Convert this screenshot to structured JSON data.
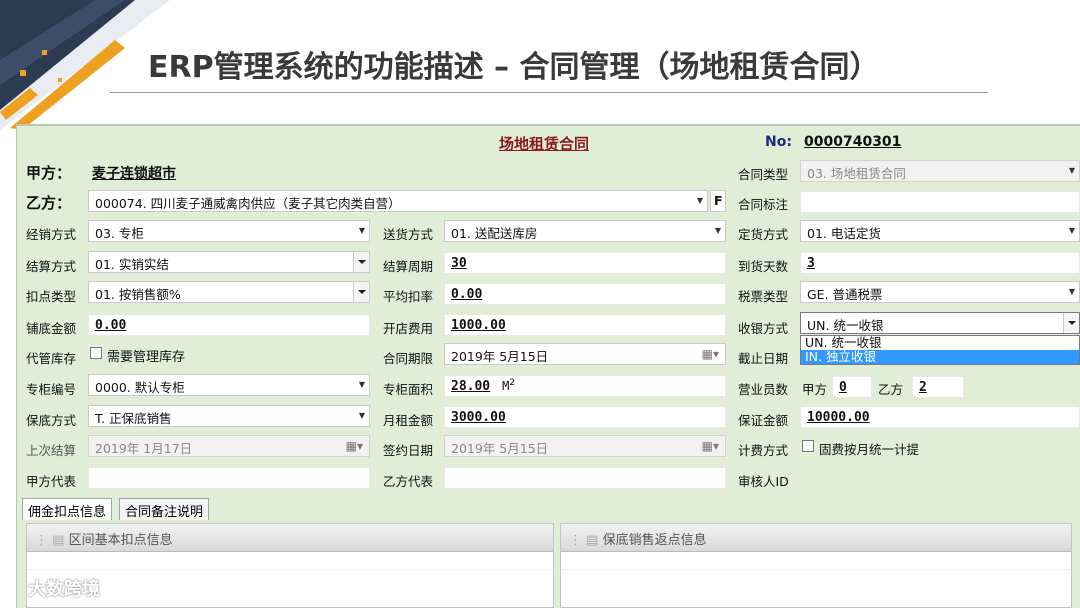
{
  "slide": {
    "title": "ERP管理系统的功能描述 – 合同管理（场地租赁合同）",
    "watermark": "大数跨境"
  },
  "form": {
    "title": "场地租赁合同",
    "no_label": "No:",
    "no_value": "0000740301",
    "party_a_label": "甲方：",
    "party_a_value": "麦子连锁超市",
    "party_b_label": "乙方：",
    "party_b_value": "000074. 四川麦子通威禽肉供应（麦子其它肉类自营）",
    "f_button": "F",
    "contract_type_label": "合同类型",
    "contract_type_value": "03. 场地租赁合同",
    "contract_tag_label": "合同标注",
    "contract_tag_value": "",
    "sales_mode_label": "经销方式",
    "sales_mode_value": "03. 专柜",
    "delivery_mode_label": "送货方式",
    "delivery_mode_value": "01. 送配送库房",
    "order_mode_label": "定货方式",
    "order_mode_value": "01. 电话定货",
    "settle_mode_label": "结算方式",
    "settle_mode_value": "01. 实销实结",
    "settle_period_label": "结算周期",
    "settle_period_value": "30",
    "arrival_days_label": "到货天数",
    "arrival_days_value": "3",
    "deduction_type_label": "扣点类型",
    "deduction_type_value": "01. 按销售额%",
    "avg_rate_label": "平均扣率",
    "avg_rate_value": "0.00",
    "tax_type_label": "税票类型",
    "tax_type_value": "GE. 普通税票",
    "base_amount_label": "铺底金额",
    "base_amount_value": "0.00",
    "opening_fee_label": "开店费用",
    "opening_fee_value": "1000.00",
    "cashier_mode_label": "收银方式",
    "cashier_mode_value": "UN. 统一收银",
    "cashier_options": [
      "UN. 统一收银",
      "IN. 独立收银"
    ],
    "consign_label": "代管库存",
    "consign_check_label": "需要管理库存",
    "contract_period_label": "合同期限",
    "contract_period_value": "2019年  5月15日",
    "end_date_label": "截止日期",
    "counter_no_label": "专柜编号",
    "counter_no_value": "0000. 默认专柜",
    "counter_area_label": "专柜面积",
    "counter_area_value": "28.00",
    "counter_area_unit": "M",
    "counter_area_sup": "2",
    "staff_label": "营业员数",
    "staff_a_label": "甲方",
    "staff_a_value": "0",
    "staff_b_label": "乙方",
    "staff_b_value": "2",
    "guarantee_mode_label": "保底方式",
    "guarantee_mode_value": "T. 正保底销售",
    "monthly_rent_label": "月租金额",
    "monthly_rent_value": "3000.00",
    "deposit_label": "保证金额",
    "deposit_value": "10000.00",
    "last_settle_label": "上次结算",
    "last_settle_value": "2019年  1月17日",
    "sign_date_label": "签约日期",
    "sign_date_value": "2019年  5月15日",
    "billing_mode_label": "计费方式",
    "billing_check_label": "固费按月统一计提",
    "rep_a_label": "甲方代表",
    "rep_b_label": "乙方代表",
    "auditor_label": "审核人ID"
  },
  "tabs": [
    "佣金扣点信息",
    "合同备注说明"
  ],
  "panels": {
    "left_title": "区间基本扣点信息",
    "right_title": "保底销售返点信息"
  }
}
